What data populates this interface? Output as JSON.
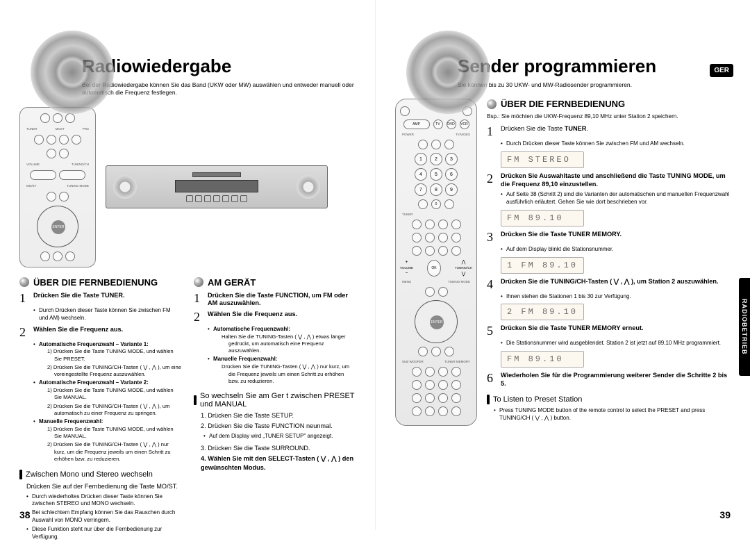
{
  "langBadge": "GER",
  "sideTab": "RADIOBETRIEB",
  "left": {
    "title": "Radiowiedergabe",
    "intro": "Bei der Radiowiedergabe können Sie das Band (UKW oder MW) auswählen und entweder manuell oder automatisch die Frequenz festlegen.",
    "sectionA": "ÜBER DIE FERNBEDIENUNG",
    "sectionB": "AM GERÄT",
    "a_step1": "Drücken Sie die Taste TUNER.",
    "a_step1_sub": "Durch Drücken dieser Taste können Sie zwischen FM und AM) wechseln.",
    "a_step2": "Wählen Sie die Frequenz aus.",
    "a2_v1_title": "Automatische Frequenzwahl – Variante 1:",
    "a2_v1_1": "1) Drücken Sie die Taste TUNING MODE, und wählen Sie PRESET.",
    "a2_v1_2": "2) Drücken Sie die TUNING/CH-Tasten ( ⋁ , ⋀ ), um eine voreingestellte Frequenz auszuwählen.",
    "a2_v2_title": "Automatische Frequenzwahl – Variante 2:",
    "a2_v2_1": "1) Drücken Sie die Taste TUNING MODE, und wählen Sie MANUAL.",
    "a2_v2_2": "2) Drücken Sie die TUNING/CH-Tasten ( ⋁ , ⋀ ), um automatisch zu einer Frequenz zu springen.",
    "a2_v3_title": "Manuelle Frequenzwahl:",
    "a2_v3_1": "1) Drücken Sie die Taste TUNING MODE, und wählen Sie MANUAL.",
    "a2_v3_2": "2) Drücken Sie die TUNING/CH-Tasten ( ⋁ , ⋀ ) nur kurz, um die Frequenz jeweils um einen Schritt zu erhöhen bzw. zu reduzieren.",
    "b_step1": "Drücken Sie die Taste FUNCTION, um FM oder AM auszuwählen.",
    "b_step2": "Wählen Sie die Frequenz aus.",
    "b2_auto_title": "Automatische Frequenzwahl:",
    "b2_auto_1": "Halten Sie die TUNING-Tasten ( ⋁ , ⋀ ) etwas länger gedrückt, um automatisch eine Frequenz auszuwählen.",
    "b2_man_title": "Manuelle Frequenzwahl:",
    "b2_man_1": "Drücken Sie die TUNING-Tasten ( ⋁ , ⋀ ) nur kurz, um die Frequenz jeweils um einen Schritt zu erhöhen bzw. zu reduzieren.",
    "subA_title": "Zwischen Mono und Stereo wechseln",
    "subA_line": "Drücken Sie auf der Fernbedienung die Taste MO/ST.",
    "subA_b1": "Durch wiederholtes Drücken dieser Taste können Sie zwischen STEREO und MONO wechseln.",
    "subA_b2": "Bei schlechtem Empfang können Sie das Rauschen durch Auswahl von MONO verringern.",
    "subA_b3": "Diese Funktion steht nur über die Fernbedienung zur Verfügung.",
    "subB_title": "So wechseln Sie am Ger t zwischen PRESET und MANUAL",
    "subB_1": "1. Drücken Sie die Taste SETUP.",
    "subB_2": "2. Drücken Sie die Taste FUNCTION neunmal.",
    "subB_2_sub": "Auf dem Display wird „TUNER SETUP\" angezeigt.",
    "subB_3": "3. Drücken Sie die Taste SURROUND.",
    "subB_4": "4. Wählen Sie mit den SELECT-Tasten ( ⋁ , ⋀ ) den gewünschten Modus.",
    "pageNum": "38"
  },
  "right": {
    "title": "Sender programmieren",
    "intro": "Sie können bis zu 30 UKW- und MW-Radiosender programmieren.",
    "section": "ÜBER DIE FERNBEDIENUNG",
    "example": "Bsp.: Sie möchten die UKW-Frequenz 89,10 MHz unter Station 2 speichern.",
    "s1": "Drücken Sie die Taste TUNER.",
    "s1_sub": "Durch Drücken dieser Taste können Sie zwischen FM und AM wechseln.",
    "lcd1": "FM STEREO",
    "s2": "Drücken Sie Auswahltaste und anschließend die Taste TUNING MODE, um die Frequenz 89,10 einzustellen.",
    "s2_sub": "Auf Seite 38 (Schritt 2) sind die Varianten der automatischen und manuellen Frequenzwahl ausführlich erläutert. Gehen Sie wie dort beschrieben vor.",
    "lcd2": "FM   89.10",
    "s3": "Drücken Sie die Taste TUNER MEMORY.",
    "s3_sub": "Auf dem Display blinkt die Stationsnummer.",
    "lcd3": "1 FM  89.10",
    "s4": "Drücken Sie die TUNING/CH-Tasten ( ⋁ , ⋀ ), um Station 2 auszuwählen.",
    "s4_sub": "Ihnen stehen die Stationen 1 bis 30 zur Verfügung.",
    "lcd4": "2 FM  89.10",
    "s5": "Drücken Sie die Taste TUNER MEMORY erneut.",
    "s5_sub": "Die Stationsnummer wird ausgeblendet. Station 2 ist jetzt auf 89,10 MHz programmiert.",
    "lcd5": "FM   89.10",
    "s6": "Wiederholen Sie für die Programmierung weiterer Sender die Schritte 2 bis 5.",
    "listen_title": "To Listen to Preset Station",
    "listen_sub": "Press TUNING MODE button of the remote control to select the PRESET and press TUNING/CH ( ⋁ , ⋀ ) button.",
    "pageNum": "39"
  }
}
